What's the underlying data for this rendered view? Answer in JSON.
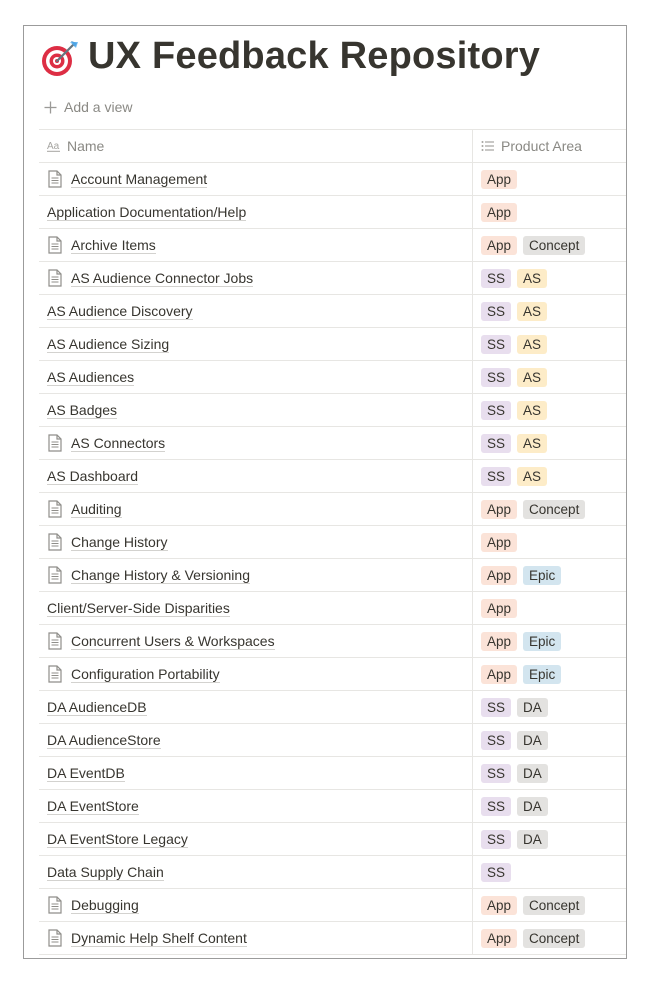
{
  "page": {
    "title": "UX Feedback Repository",
    "icon": "dart-target-icon"
  },
  "add_view_label": "Add a view",
  "columns": [
    {
      "label": "Name",
      "icon": "text-aa-icon"
    },
    {
      "label": "Product Area",
      "icon": "list-icon"
    }
  ],
  "tag_colors": {
    "App": "#fbe3d8",
    "Concept": "#e3e2e0",
    "SS": "#e8deee",
    "AS": "#fdecc8",
    "Epic": "#d3e5ef",
    "DA": "#e3e2e0"
  },
  "rows": [
    {
      "name": "Account Management",
      "has_doc": true,
      "tags": [
        "App"
      ]
    },
    {
      "name": "Application Documentation/Help",
      "has_doc": false,
      "tags": [
        "App"
      ]
    },
    {
      "name": "Archive Items",
      "has_doc": true,
      "tags": [
        "App",
        "Concept"
      ]
    },
    {
      "name": "AS Audience Connector Jobs",
      "has_doc": true,
      "tags": [
        "SS",
        "AS"
      ]
    },
    {
      "name": "AS Audience Discovery",
      "has_doc": false,
      "tags": [
        "SS",
        "AS"
      ]
    },
    {
      "name": "AS Audience Sizing",
      "has_doc": false,
      "tags": [
        "SS",
        "AS"
      ]
    },
    {
      "name": "AS Audiences",
      "has_doc": false,
      "tags": [
        "SS",
        "AS"
      ]
    },
    {
      "name": "AS Badges",
      "has_doc": false,
      "tags": [
        "SS",
        "AS"
      ]
    },
    {
      "name": "AS Connectors",
      "has_doc": true,
      "tags": [
        "SS",
        "AS"
      ]
    },
    {
      "name": "AS Dashboard",
      "has_doc": false,
      "tags": [
        "SS",
        "AS"
      ]
    },
    {
      "name": "Auditing",
      "has_doc": true,
      "tags": [
        "App",
        "Concept"
      ]
    },
    {
      "name": "Change History",
      "has_doc": true,
      "tags": [
        "App"
      ]
    },
    {
      "name": "Change History & Versioning",
      "has_doc": true,
      "tags": [
        "App",
        "Epic"
      ]
    },
    {
      "name": "Client/Server-Side Disparities",
      "has_doc": false,
      "tags": [
        "App"
      ]
    },
    {
      "name": "Concurrent Users & Workspaces",
      "has_doc": true,
      "tags": [
        "App",
        "Epic"
      ]
    },
    {
      "name": "Configuration Portability",
      "has_doc": true,
      "tags": [
        "App",
        "Epic"
      ]
    },
    {
      "name": "DA AudienceDB",
      "has_doc": false,
      "tags": [
        "SS",
        "DA"
      ]
    },
    {
      "name": "DA AudienceStore",
      "has_doc": false,
      "tags": [
        "SS",
        "DA"
      ]
    },
    {
      "name": "DA EventDB",
      "has_doc": false,
      "tags": [
        "SS",
        "DA"
      ]
    },
    {
      "name": "DA EventStore",
      "has_doc": false,
      "tags": [
        "SS",
        "DA"
      ]
    },
    {
      "name": "DA EventStore Legacy",
      "has_doc": false,
      "tags": [
        "SS",
        "DA"
      ]
    },
    {
      "name": "Data Supply Chain",
      "has_doc": false,
      "tags": [
        "SS"
      ]
    },
    {
      "name": "Debugging",
      "has_doc": true,
      "tags": [
        "App",
        "Concept"
      ]
    },
    {
      "name": "Dynamic Help Shelf Content",
      "has_doc": true,
      "tags": [
        "App",
        "Concept"
      ]
    }
  ]
}
